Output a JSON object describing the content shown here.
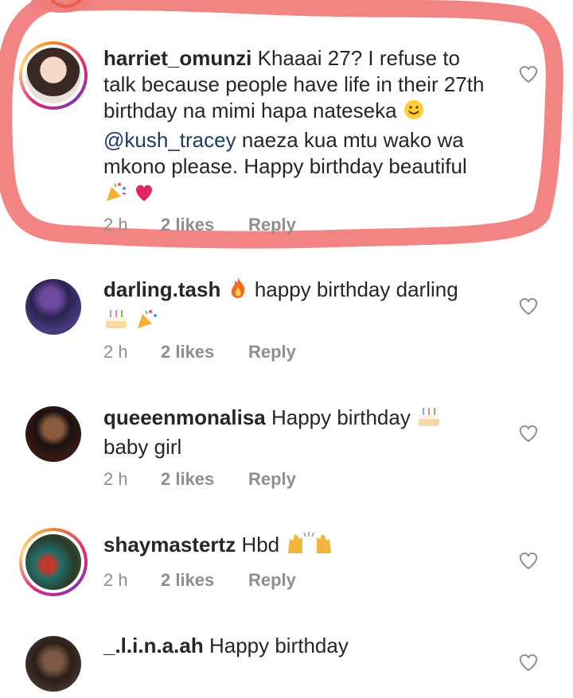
{
  "comments": [
    {
      "username": "harriet_omunzi",
      "text_a": "Khaaai 27? I refuse to talk because people have life in their 27th birthday na mimi hapa nateseka",
      "mention": "@kush_tracey",
      "text_b": "naeza kua mtu wako wa mkono please. Happy birthday beautiful",
      "time": "2 h",
      "likes": "2 likes",
      "reply": "Reply"
    },
    {
      "username": "darling.tash",
      "text": "happy birthday darling",
      "time": "2 h",
      "likes": "2 likes",
      "reply": "Reply"
    },
    {
      "username": "queeenmonalisa",
      "text_a": "Happy birthday",
      "text_b": "baby girl",
      "time": "2 h",
      "likes": "2 likes",
      "reply": "Reply"
    },
    {
      "username": "shaymastertz",
      "text": "Hbd",
      "time": "2 h",
      "likes": "2 likes",
      "reply": "Reply"
    },
    {
      "username": "_.l.i.n.a.ah",
      "text": "Happy birthday"
    }
  ],
  "colors": {
    "text": "#262626",
    "meta": "#8e8e8e",
    "mention": "#1e3a66",
    "highlight": "#f27a7a"
  },
  "icons": [
    "heart-outline-icon",
    "party-popper-emoji",
    "red-heart-emoji",
    "fire-emoji",
    "birthday-cake-emoji",
    "raising-hands-emoji",
    "smiling-face-emoji"
  ]
}
